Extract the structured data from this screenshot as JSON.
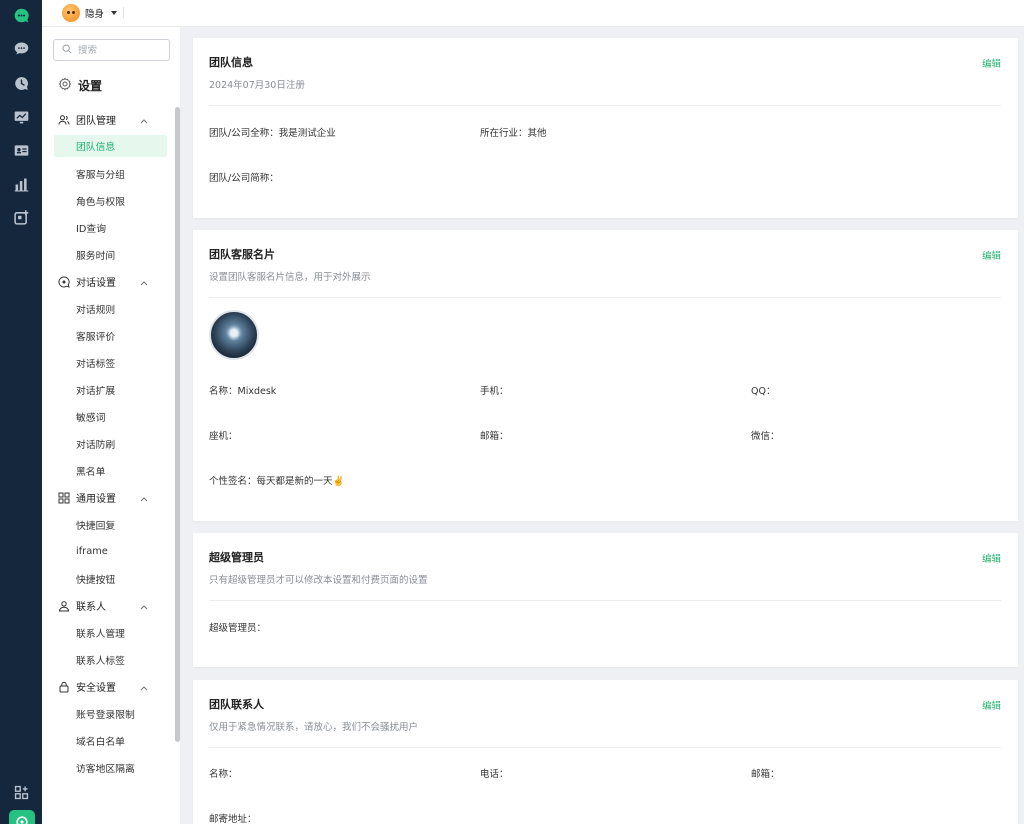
{
  "topbar": {
    "status_label": "隐身"
  },
  "sidebar": {
    "search_placeholder": "搜索",
    "title": "设置",
    "groups": [
      {
        "label": "团队管理",
        "items": [
          "团队信息",
          "客服与分组",
          "角色与权限",
          "ID查询",
          "服务时间"
        ]
      },
      {
        "label": "对话设置",
        "items": [
          "对话规则",
          "客服评价",
          "对话标签",
          "对话扩展",
          "敏感词",
          "对话防刷",
          "黑名单"
        ]
      },
      {
        "label": "通用设置",
        "items": [
          "快捷回复",
          "iframe",
          "快捷按钮"
        ]
      },
      {
        "label": "联系人",
        "items": [
          "联系人管理",
          "联系人标签"
        ]
      },
      {
        "label": "安全设置",
        "items": [
          "账号登录限制",
          "域名白名单",
          "访客地区隔离"
        ]
      }
    ]
  },
  "cards": {
    "team_info": {
      "title": "团队信息",
      "subtitle": "2024年07月30日注册",
      "edit": "编辑",
      "fullname_label": "团队/公司全称：",
      "fullname_value": "我是测试企业",
      "industry_label": "所在行业：",
      "industry_value": "其他",
      "shortname_label": "团队/公司简称："
    },
    "service_card": {
      "title": "团队客服名片",
      "subtitle": "设置团队客服名片信息，用于对外展示",
      "edit": "编辑",
      "name_label": "名称：",
      "name_value": "Mixdesk",
      "mobile_label": "手机：",
      "qq_label": "QQ：",
      "phone_label": "座机：",
      "email_label": "邮箱：",
      "wechat_label": "微信：",
      "signature_label": "个性签名：",
      "signature_value": "每天都是新的一天✌️"
    },
    "super_admin": {
      "title": "超级管理员",
      "subtitle": "只有超级管理员才可以修改本设置和付费页面的设置",
      "edit": "编辑",
      "admin_label": "超级管理员："
    },
    "contact": {
      "title": "团队联系人",
      "subtitle": "仅用于紧急情况联系，请放心，我们不会骚扰用户",
      "edit": "编辑",
      "name_label": "名称：",
      "phone_label": "电话：",
      "email_label": "邮箱：",
      "address_label": "邮寄地址："
    }
  },
  "colors": {
    "accent": "#25b36f",
    "rail": "#15273d",
    "active_bg": "#e6f8ee"
  }
}
